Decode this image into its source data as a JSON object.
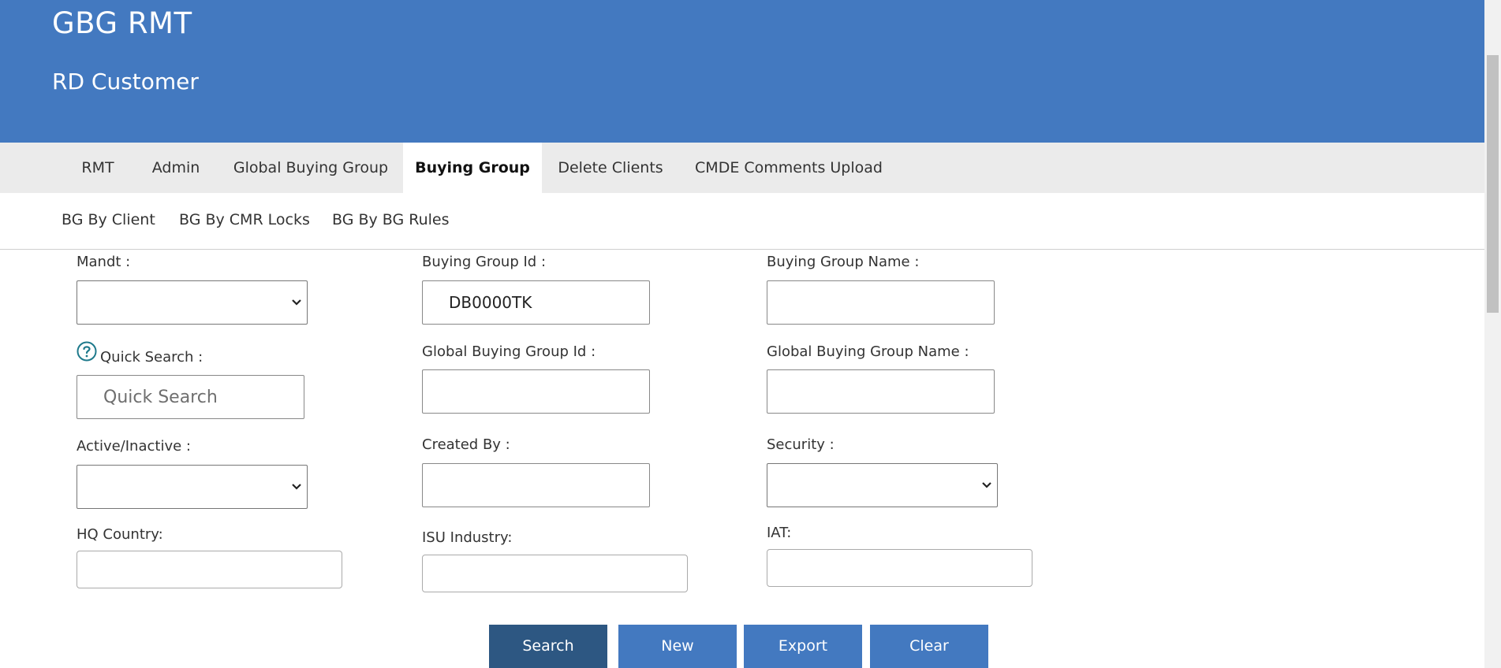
{
  "header": {
    "app_title": "GBG RMT",
    "page_title": "RD Customer"
  },
  "main_nav": {
    "tabs": [
      {
        "label": "RMT"
      },
      {
        "label": "Admin"
      },
      {
        "label": "Global Buying Group"
      },
      {
        "label": "Buying Group",
        "active": true
      },
      {
        "label": "Delete Clients"
      },
      {
        "label": "CMDE Comments Upload"
      }
    ]
  },
  "sub_nav": {
    "tabs": [
      {
        "label": "BG By Client"
      },
      {
        "label": "BG By CMR Locks"
      },
      {
        "label": "BG By BG Rules"
      }
    ]
  },
  "form": {
    "mandt": {
      "label": "Mandt :",
      "value": ""
    },
    "buying_group_id": {
      "label": "Buying Group Id :",
      "value": "DB0000TK"
    },
    "buying_group_name": {
      "label": "Buying Group Name :",
      "value": ""
    },
    "quick_search": {
      "label": "Quick Search :",
      "placeholder": "Quick Search",
      "value": ""
    },
    "global_buying_group_id": {
      "label": "Global Buying Group Id :",
      "value": ""
    },
    "global_buying_group_name": {
      "label": "Global Buying Group Name :",
      "value": ""
    },
    "active_inactive": {
      "label": "Active/Inactive :",
      "value": ""
    },
    "created_by": {
      "label": "Created By :",
      "value": ""
    },
    "security": {
      "label": "Security :",
      "value": ""
    },
    "hq_country": {
      "label": "HQ Country:",
      "value": ""
    },
    "isu_industry": {
      "label": "ISU Industry:",
      "value": ""
    },
    "iat": {
      "label": "IAT:",
      "value": ""
    }
  },
  "actions": {
    "search": "Search",
    "new": "New",
    "export": "Export",
    "clear": "Clear"
  },
  "icons": {
    "help": "help-circle-icon",
    "dropdown": "chevron-down-icon"
  },
  "colors": {
    "header_bg": "#4379c0",
    "primary_button": "#2d5782",
    "button": "#4379c0",
    "help_icon": "#1f7a8c"
  }
}
